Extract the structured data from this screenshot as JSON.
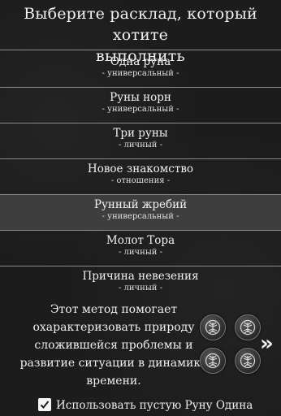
{
  "header": {
    "title_line1": "Выберите расклад, который хотите",
    "title_line2": "выполнить"
  },
  "spreads": [
    {
      "name": "Одна руна",
      "category": "- универсальный -"
    },
    {
      "name": "Руны норн",
      "category": "- универсальный -"
    },
    {
      "name": "Три руны",
      "category": "- личный -"
    },
    {
      "name": "Новое знакомство",
      "category": "- отношения -"
    },
    {
      "name": "Рунный жребий",
      "category": "- универсальный -",
      "selected": true
    },
    {
      "name": "Молот Тора",
      "category": "- личный -"
    },
    {
      "name": "Причина невезения",
      "category": "- личный -"
    }
  ],
  "description": {
    "lines": [
      "Этот метод помогает",
      "охарактеризовать природу",
      "сложившейся проблемы и",
      "развитие ситуации в динамике",
      "времени."
    ]
  },
  "rune_icons": [
    "yggdrasil-rune-icon",
    "yggdrasil-rune-icon",
    "yggdrasil-rune-icon",
    "yggdrasil-rune-icon"
  ],
  "next_button": {
    "icon": "double-chevron-right-icon",
    "glyph": "»"
  },
  "options": {
    "empty_rune_label": "Использовать пустую Руну Одина",
    "empty_rune_checked": true
  },
  "colors": {
    "background": "#1c1c1c",
    "selected_row": "#3e3e3e",
    "divider": "#8a8a8a",
    "text": "#f0f0f0"
  }
}
